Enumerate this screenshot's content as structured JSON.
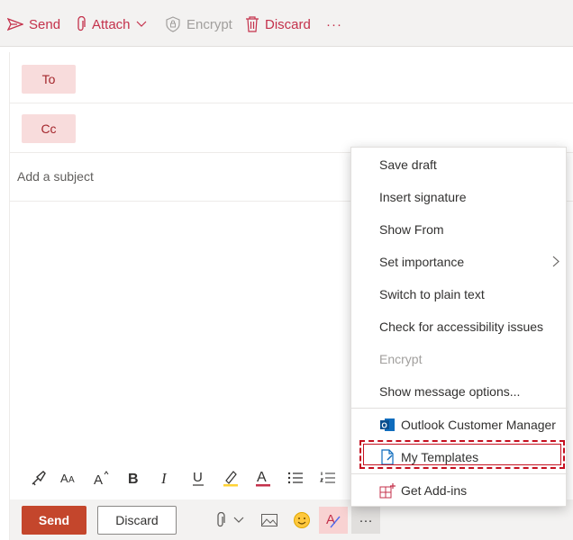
{
  "toolbar": {
    "send": "Send",
    "attach": "Attach",
    "encrypt": "Encrypt",
    "discard": "Discard",
    "more": "···"
  },
  "compose": {
    "to_label": "To",
    "cc_label": "Cc",
    "subject_placeholder": "Add a subject"
  },
  "bottom": {
    "send": "Send",
    "discard": "Discard",
    "more": "···"
  },
  "menu": {
    "items": [
      "Save draft",
      "Insert signature",
      "Show From",
      "Set importance",
      "Switch to plain text",
      "Check for accessibility issues",
      "Encrypt",
      "Show message options..."
    ],
    "addins": [
      "Outlook Customer Manager",
      "My Templates",
      "Get Add-ins"
    ]
  },
  "colors": {
    "accent": "#c4314b",
    "send_button": "#c4462c",
    "recipient_button_bg": "#f8dcdc",
    "highlight": "#c50f1f"
  }
}
